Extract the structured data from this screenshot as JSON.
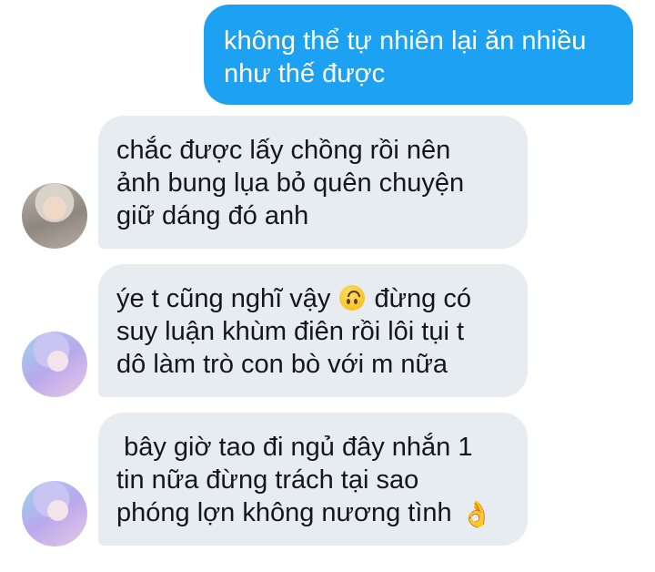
{
  "messages": [
    {
      "direction": "sent",
      "text": "không thể tự nhiên lại ăn nhiều\nnhư thế được"
    },
    {
      "direction": "received",
      "text": "chắc được lấy chồng rồi nên\nảnh bung lụa bỏ quên chuyện\ngiữ dáng đó anh"
    },
    {
      "direction": "received",
      "text_before_emoji": "ýe t cũng nghĩ vậy ",
      "emoji": "upside-down-face",
      "text_after_emoji": " đừng có\nsuy luận khùm điên rồi lôi tụi t\ndô làm trò con bò với m nữa"
    },
    {
      "direction": "received",
      "text": " bây giờ tao đi ngủ đây nhắn 1\ntin nữa đừng trách tại sao\nphóng lợn không nương tình ",
      "emoji": "ok-hand"
    }
  ],
  "colors": {
    "sent_bubble": "#1da1f2",
    "received_bubble": "#e6ecf0",
    "received_text": "#14171a",
    "sent_text": "#ffffff"
  }
}
